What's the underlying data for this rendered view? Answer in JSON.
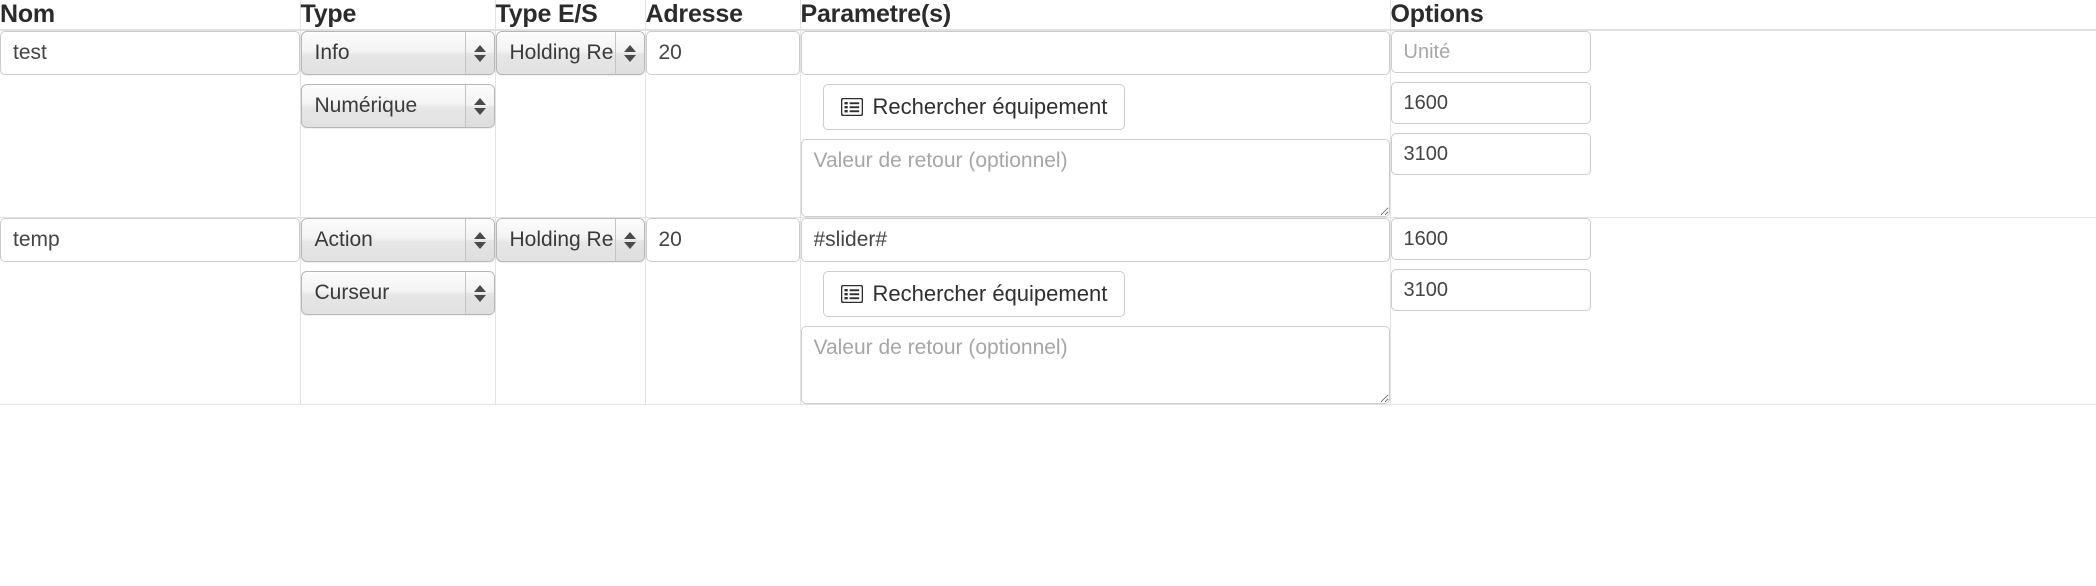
{
  "table": {
    "columns": [
      {
        "key": "nom",
        "label": "Nom"
      },
      {
        "key": "type",
        "label": "Type"
      },
      {
        "key": "type_es",
        "label": "Type E/S"
      },
      {
        "key": "adresse",
        "label": "Adresse"
      },
      {
        "key": "param",
        "label": "Parametre(s)"
      },
      {
        "key": "options",
        "label": "Options"
      }
    ],
    "rows": [
      {
        "nom_value": "test",
        "nom_placeholder": "",
        "type_select": "Info",
        "subtype_select": "Numérique",
        "type_es_select": "Holding Re",
        "adresse_value": "20",
        "param_value": "",
        "param_placeholder": "",
        "search_button_label": "Rechercher équipement",
        "return_value": "",
        "return_placeholder": "Valeur de retour (optionnel)",
        "options": [
          {
            "value": "",
            "placeholder": "Unité"
          },
          {
            "value": "1600",
            "placeholder": ""
          },
          {
            "value": "3100",
            "placeholder": ""
          }
        ]
      },
      {
        "nom_value": "temp",
        "nom_placeholder": "",
        "type_select": "Action",
        "subtype_select": "Curseur",
        "type_es_select": "Holding Re",
        "adresse_value": "20",
        "param_value": "#slider#",
        "param_placeholder": "",
        "search_button_label": "Rechercher équipement",
        "return_value": "",
        "return_placeholder": "Valeur de retour (optionnel)",
        "options": [
          {
            "value": "1600",
            "placeholder": ""
          },
          {
            "value": "3100",
            "placeholder": ""
          }
        ]
      }
    ]
  },
  "icons": {
    "search_equipment": "list-icon",
    "select_stepper": "chevron-up-down-icon",
    "resize_grip": "resize-grip-icon"
  },
  "colors": {
    "border": "#e3e3e3",
    "input_border": "#cccccc",
    "text": "#2b2b2b",
    "placeholder": "#a6a6a6",
    "select_face": "#f0f0f0"
  }
}
